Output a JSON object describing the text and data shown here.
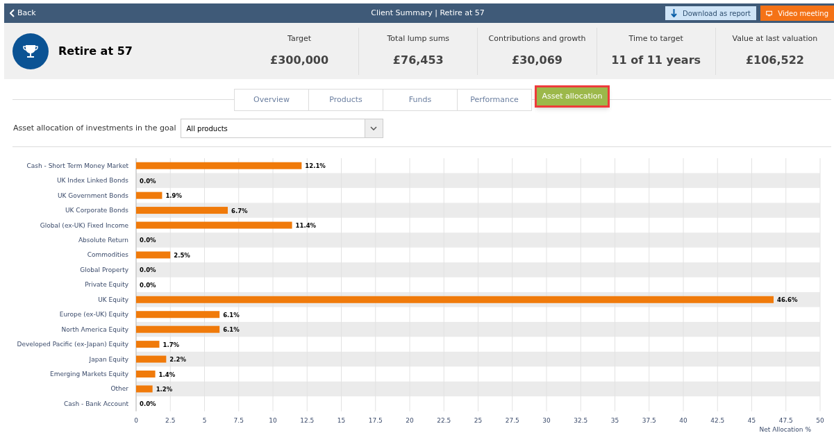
{
  "top_bar": {
    "back": "Back",
    "title": "Client Summary | Retire at 57",
    "download_button": "Download as report",
    "video_button": "Video meeting"
  },
  "goal": {
    "name": "Retire at 57"
  },
  "stats": [
    {
      "label": "Target",
      "value": "£300,000"
    },
    {
      "label": "Total lump sums",
      "value": "£76,453"
    },
    {
      "label": "Contributions and growth",
      "value": "£30,069"
    },
    {
      "label": "Time to target",
      "value": "11 of 11 years"
    },
    {
      "label": "Value at last valuation",
      "value": "£106,522"
    }
  ],
  "tabs": [
    {
      "label": "Overview",
      "selected": false
    },
    {
      "label": "Products",
      "selected": false
    },
    {
      "label": "Funds",
      "selected": false
    },
    {
      "label": "Performance",
      "selected": false
    },
    {
      "label": "Asset allocation",
      "selected": true
    }
  ],
  "filter": {
    "label": "Asset allocation of investments in the goal",
    "value": "All products"
  },
  "chart_data": {
    "type": "bar",
    "orientation": "horizontal",
    "xlabel": "Net Allocation %",
    "categories": [
      "Cash - Short Term Money Market",
      "UK Index Linked Bonds",
      "UK Government Bonds",
      "UK Corporate Bonds",
      "Global (ex-UK) Fixed Income",
      "Absolute Return",
      "Commodities",
      "Global Property",
      "Private Equity",
      "UK Equity",
      "Europe (ex-UK) Equity",
      "North America Equity",
      "Developed Pacific (ex-Japan) Equity",
      "Japan Equity",
      "Emerging Markets Equity",
      "Other",
      "Cash - Bank Account"
    ],
    "grid": true,
    "series": [
      {
        "color": "#f07a0a",
        "values": [
          12.1,
          0.0,
          1.9,
          6.7,
          11.4,
          0.0,
          2.5,
          0.0,
          0.0,
          46.6,
          6.1,
          6.1,
          1.7,
          2.2,
          1.4,
          1.2,
          0.0
        ]
      }
    ],
    "value_labels": [
      "12.1%",
      "0.0%",
      "1.9%",
      "6.7%",
      "11.4%",
      "0.0%",
      "2.5%",
      "0.0%",
      "0.0%",
      "46.6%",
      "6.1%",
      "6.1%",
      "1.7%",
      "2.2%",
      "1.4%",
      "1.2%",
      "0.0%"
    ],
    "xlim": [
      0,
      50
    ],
    "xticks": [
      0,
      {
        "value": 2.5,
        "label": "2.5"
      },
      5,
      {
        "value": 7.5,
        "label": "7.5"
      },
      10,
      {
        "value": 12.5,
        "label": "12.5"
      },
      15,
      {
        "value": 17.5,
        "label": "17.5"
      },
      20,
      {
        "value": 22.5,
        "label": "22.5"
      },
      25,
      {
        "value": 27.5,
        "label": "27.5"
      },
      30,
      {
        "value": 32.5,
        "label": "32.5"
      },
      35,
      {
        "value": 37.5,
        "label": "37.5"
      },
      40,
      {
        "value": 42.5,
        "label": "42.5"
      },
      45,
      {
        "value": 47.5,
        "label": "47.5"
      },
      50
    ]
  }
}
